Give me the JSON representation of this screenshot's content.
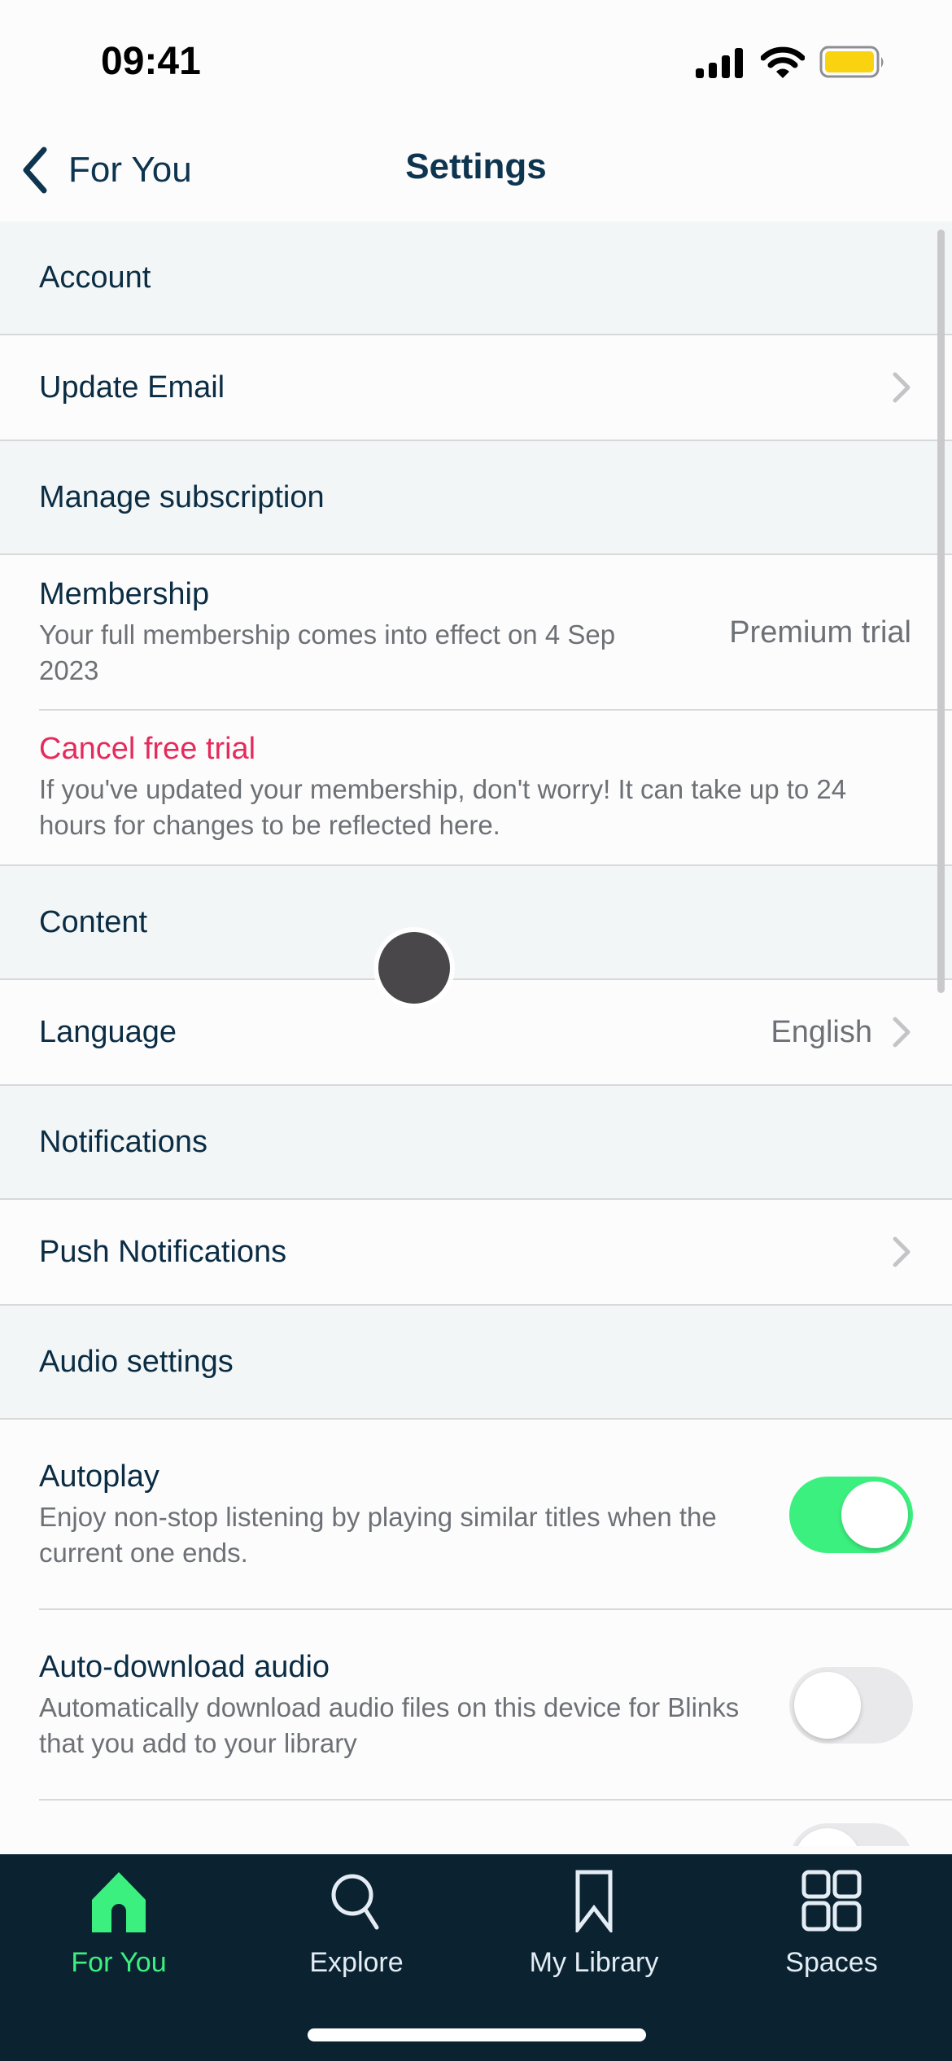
{
  "status_bar": {
    "time": "09:41",
    "icons": [
      "cellular-signal-icon",
      "wifi-icon",
      "battery-icon"
    ],
    "battery_color": "#F9D30F"
  },
  "nav": {
    "back_label": "For You",
    "title": "Settings"
  },
  "sections": [
    {
      "header": "Account",
      "rows": [
        {
          "title": "Update Email",
          "chevron": true
        }
      ]
    },
    {
      "header": "Manage subscription",
      "rows": [
        {
          "title": "Membership",
          "subtitle": "Your full membership comes into effect on 4 Sep 2023",
          "value": "Premium trial"
        },
        {
          "title": "Cancel free trial",
          "subtitle": "If you've updated your membership, don't worry! It can take up to 24 hours for changes to be reflected here.",
          "style": "danger"
        }
      ]
    },
    {
      "header": "Content",
      "rows": [
        {
          "title": "Language",
          "value": "English",
          "chevron": true
        }
      ]
    },
    {
      "header": "Notifications",
      "rows": [
        {
          "title": "Push Notifications",
          "chevron": true
        }
      ]
    },
    {
      "header": "Audio settings",
      "rows": [
        {
          "title": "Autoplay",
          "subtitle": "Enjoy non-stop listening by playing similar titles when the current one ends.",
          "toggle": true
        },
        {
          "title": "Auto-download audio",
          "subtitle": "Automatically download audio files on this device for Blinks that you add to your library",
          "toggle": false
        }
      ]
    }
  ],
  "tab_bar": {
    "tabs": [
      {
        "label": "For You",
        "icon": "home-icon",
        "active": true
      },
      {
        "label": "Explore",
        "icon": "search-icon",
        "active": false
      },
      {
        "label": "My Library",
        "icon": "bookmark-icon",
        "active": false
      },
      {
        "label": "Spaces",
        "icon": "grid-icon",
        "active": false
      }
    ]
  },
  "colors": {
    "accent_green": "#3CF07F",
    "danger": "#E52B5B",
    "text_primary": "#0B2D44",
    "text_secondary": "#6D7176",
    "section_bg": "#F3F6F6",
    "tab_bar_bg": "#0B2331"
  }
}
